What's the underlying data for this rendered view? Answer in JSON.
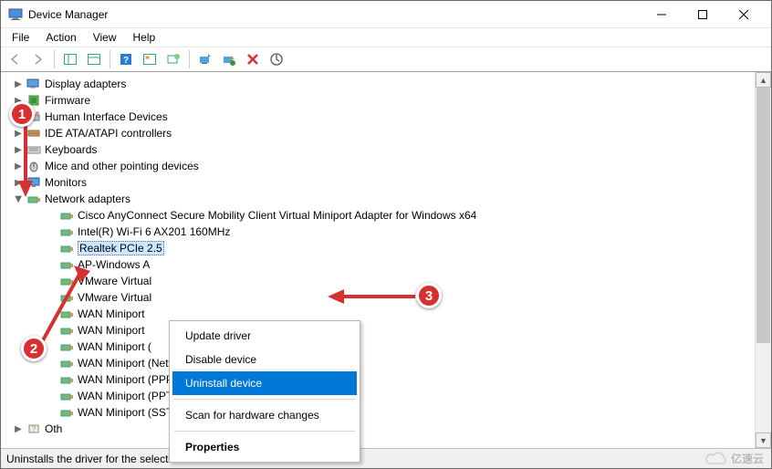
{
  "window": {
    "title": "Device Manager"
  },
  "menubar": {
    "file": "File",
    "action": "Action",
    "view": "View",
    "help": "Help"
  },
  "tree": {
    "display_adapters": "Display adapters",
    "firmware": "Firmware",
    "hid": "Human Interface Devices",
    "ide": "IDE ATA/ATAPI controllers",
    "keyboards": "Keyboards",
    "mice": "Mice and other pointing devices",
    "monitors": "Monitors",
    "network_adapters": "Network adapters",
    "net_children": {
      "cisco": "Cisco AnyConnect Secure Mobility Client Virtual Miniport Adapter for Windows x64",
      "intel": "Intel(R) Wi-Fi 6 AX201 160MHz",
      "realtek": "Realtek PCIe 2.5",
      "tap": "AP-Windows A",
      "vmware1": "VMware Virtual",
      "vmware2": "VMware Virtual",
      "wan1": "WAN Miniport",
      "wan2": "WAN Miniport",
      "wan3": "WAN Miniport (",
      "wan4": "WAN Miniport (Network Monitor)",
      "wan5": "WAN Miniport (PPPOE)",
      "wan6": "WAN Miniport (PPTP)",
      "wan7": "WAN Miniport (SSTP)"
    },
    "other": "Oth"
  },
  "context_menu": {
    "update": "Update driver",
    "disable": "Disable device",
    "uninstall": "Uninstall device",
    "scan": "Scan for hardware changes",
    "properties": "Properties"
  },
  "statusbar": {
    "text": "Uninstalls the driver for the selected device."
  },
  "annotations": {
    "marker1": "1",
    "marker2": "2",
    "marker3": "3"
  },
  "watermark": {
    "text": "亿速云"
  }
}
